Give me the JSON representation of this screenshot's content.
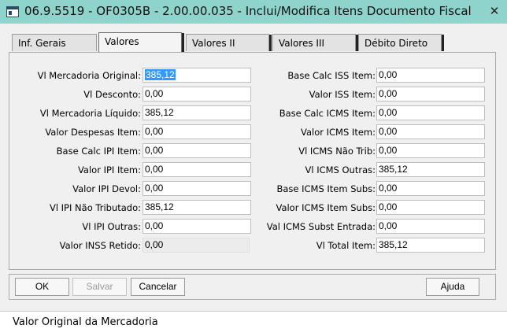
{
  "window": {
    "title": "06.9.5519 - OF0305B - 2.00.00.035 - Inclui/Modifica Itens Documento Fiscal",
    "close_glyph": "✕"
  },
  "tabs": [
    {
      "label": "Inf. Gerais",
      "active": false
    },
    {
      "label": "Valores",
      "active": true
    },
    {
      "label": "Valores II",
      "active": false
    },
    {
      "label": "Valores III",
      "active": false
    },
    {
      "label": "Débito Direto",
      "active": false
    }
  ],
  "left_fields": [
    {
      "label": "Vl Mercadoria Original:",
      "value": "385,12",
      "selected": true
    },
    {
      "label": "Vl Desconto:",
      "value": "0,00"
    },
    {
      "label": "Vl Mercadoria Líquido:",
      "value": "385,12"
    },
    {
      "label": "Valor Despesas Item:",
      "value": "0,00"
    },
    {
      "label": "Base Calc IPI Item:",
      "value": "0,00"
    },
    {
      "label": "Valor IPI Item:",
      "value": "0,00"
    },
    {
      "label": "Valor IPI Devol:",
      "value": "0,00"
    },
    {
      "label": "Vl IPI Não Tributado:",
      "value": "385,12"
    },
    {
      "label": "Vl IPI Outras:",
      "value": "0,00"
    },
    {
      "label": "Valor INSS Retido:",
      "value": "0,00",
      "readonly": true
    }
  ],
  "right_fields": [
    {
      "label": "Base Calc ISS Item:",
      "value": "0,00"
    },
    {
      "label": "Valor ISS Item:",
      "value": "0,00"
    },
    {
      "label": "Base Calc ICMS Item:",
      "value": "0,00"
    },
    {
      "label": "Valor ICMS Item:",
      "value": "0,00"
    },
    {
      "label": "Vl ICMS Não Trib:",
      "value": "0,00"
    },
    {
      "label": "Vl ICMS Outras:",
      "value": "385,12"
    },
    {
      "label": "Base ICMS Item Subs:",
      "value": "0,00"
    },
    {
      "label": "Valor ICMS Item Subs:",
      "value": "0,00"
    },
    {
      "label": "Val ICMS Subst Entrada:",
      "value": "0,00"
    },
    {
      "label": "Vl Total Item:",
      "value": "385,12"
    }
  ],
  "buttons": {
    "ok": "OK",
    "save": "Salvar",
    "cancel": "Cancelar",
    "help": "Ajuda"
  },
  "status": {
    "text": "Valor Original da Mercadoria"
  }
}
